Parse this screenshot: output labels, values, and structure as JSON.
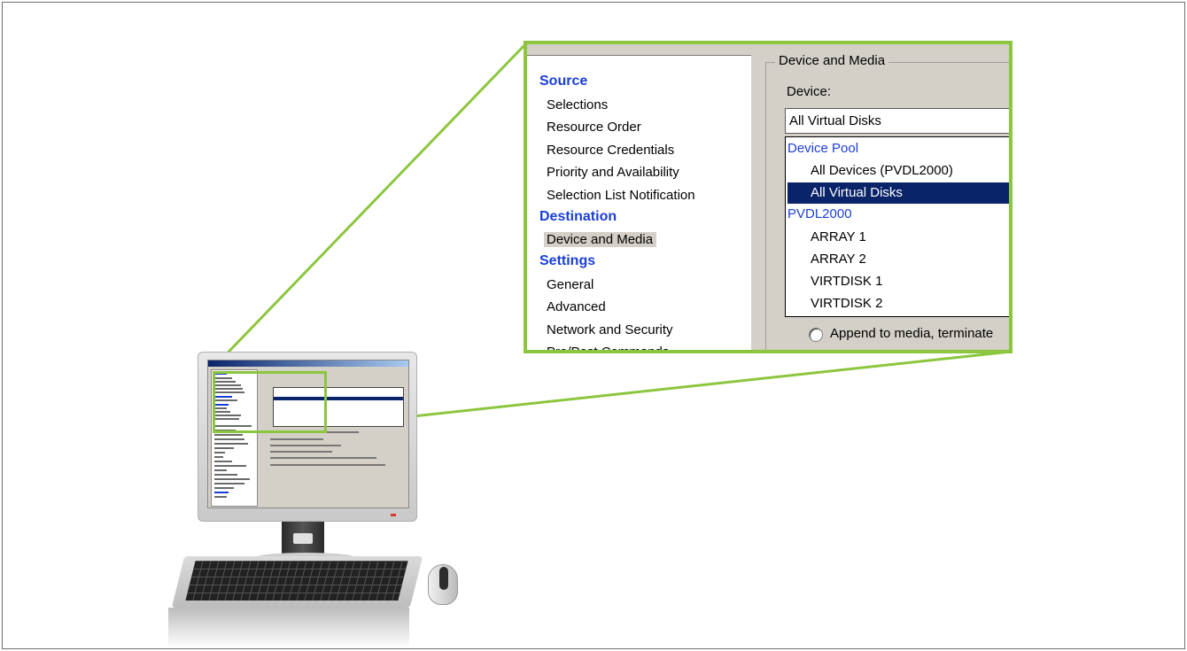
{
  "zoom_panel": {
    "nav": {
      "sections": [
        {
          "heading": "Source",
          "items": [
            "Selections",
            "Resource Order",
            "Resource Credentials",
            "Priority and Availability",
            "Selection List Notification"
          ]
        },
        {
          "heading": "Destination",
          "items": [
            "Device and Media"
          ]
        },
        {
          "heading": "Settings",
          "items": [
            "General",
            "Advanced",
            "Network and Security",
            "Pre/Post Commands"
          ]
        }
      ],
      "selected_item": "Device and Media"
    },
    "group_title": "Device and Media",
    "device_label": "Device:",
    "device_value": "All Virtual Disks",
    "dropdown": {
      "groups": [
        {
          "heading": "Device Pool",
          "items": [
            "All Devices (PVDL2000)",
            "All Virtual Disks"
          ]
        },
        {
          "heading": "PVDL2000",
          "items": [
            "ARRAY 1",
            "ARRAY 2",
            "VIRTDISK 1",
            "VIRTDISK 2"
          ]
        }
      ],
      "highlighted": "All Virtual Disks"
    },
    "radio_label": "Append to media, terminate"
  },
  "colors": {
    "callout_green": "#8cc63f",
    "heading_blue": "#1a3fd6",
    "selection_navy": "#0a246a",
    "dialog_gray": "#d4d0c8"
  },
  "icons": [
    "monitor-icon",
    "keyboard-icon",
    "mouse-icon"
  ]
}
